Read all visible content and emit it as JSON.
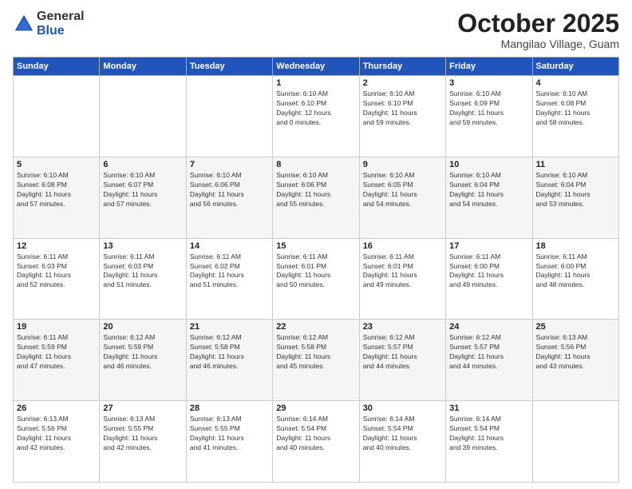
{
  "logo": {
    "general": "General",
    "blue": "Blue"
  },
  "header": {
    "month": "October 2025",
    "location": "Mangilao Village, Guam"
  },
  "weekdays": [
    "Sunday",
    "Monday",
    "Tuesday",
    "Wednesday",
    "Thursday",
    "Friday",
    "Saturday"
  ],
  "weeks": [
    [
      {
        "day": "",
        "info": ""
      },
      {
        "day": "",
        "info": ""
      },
      {
        "day": "",
        "info": ""
      },
      {
        "day": "1",
        "info": "Sunrise: 6:10 AM\nSunset: 6:10 PM\nDaylight: 12 hours\nand 0 minutes."
      },
      {
        "day": "2",
        "info": "Sunrise: 6:10 AM\nSunset: 6:10 PM\nDaylight: 11 hours\nand 59 minutes."
      },
      {
        "day": "3",
        "info": "Sunrise: 6:10 AM\nSunset: 6:09 PM\nDaylight: 11 hours\nand 59 minutes."
      },
      {
        "day": "4",
        "info": "Sunrise: 6:10 AM\nSunset: 6:08 PM\nDaylight: 11 hours\nand 58 minutes."
      }
    ],
    [
      {
        "day": "5",
        "info": "Sunrise: 6:10 AM\nSunset: 6:08 PM\nDaylight: 11 hours\nand 57 minutes."
      },
      {
        "day": "6",
        "info": "Sunrise: 6:10 AM\nSunset: 6:07 PM\nDaylight: 11 hours\nand 57 minutes."
      },
      {
        "day": "7",
        "info": "Sunrise: 6:10 AM\nSunset: 6:06 PM\nDaylight: 11 hours\nand 56 minutes."
      },
      {
        "day": "8",
        "info": "Sunrise: 6:10 AM\nSunset: 6:06 PM\nDaylight: 11 hours\nand 55 minutes."
      },
      {
        "day": "9",
        "info": "Sunrise: 6:10 AM\nSunset: 6:05 PM\nDaylight: 11 hours\nand 54 minutes."
      },
      {
        "day": "10",
        "info": "Sunrise: 6:10 AM\nSunset: 6:04 PM\nDaylight: 11 hours\nand 54 minutes."
      },
      {
        "day": "11",
        "info": "Sunrise: 6:10 AM\nSunset: 6:04 PM\nDaylight: 11 hours\nand 53 minutes."
      }
    ],
    [
      {
        "day": "12",
        "info": "Sunrise: 6:11 AM\nSunset: 6:03 PM\nDaylight: 11 hours\nand 52 minutes."
      },
      {
        "day": "13",
        "info": "Sunrise: 6:11 AM\nSunset: 6:03 PM\nDaylight: 11 hours\nand 51 minutes."
      },
      {
        "day": "14",
        "info": "Sunrise: 6:11 AM\nSunset: 6:02 PM\nDaylight: 11 hours\nand 51 minutes."
      },
      {
        "day": "15",
        "info": "Sunrise: 6:11 AM\nSunset: 6:01 PM\nDaylight: 11 hours\nand 50 minutes."
      },
      {
        "day": "16",
        "info": "Sunrise: 6:11 AM\nSunset: 6:01 PM\nDaylight: 11 hours\nand 49 minutes."
      },
      {
        "day": "17",
        "info": "Sunrise: 6:11 AM\nSunset: 6:00 PM\nDaylight: 11 hours\nand 49 minutes."
      },
      {
        "day": "18",
        "info": "Sunrise: 6:11 AM\nSunset: 6:00 PM\nDaylight: 11 hours\nand 48 minutes."
      }
    ],
    [
      {
        "day": "19",
        "info": "Sunrise: 6:11 AM\nSunset: 5:59 PM\nDaylight: 11 hours\nand 47 minutes."
      },
      {
        "day": "20",
        "info": "Sunrise: 6:12 AM\nSunset: 5:59 PM\nDaylight: 11 hours\nand 46 minutes."
      },
      {
        "day": "21",
        "info": "Sunrise: 6:12 AM\nSunset: 5:58 PM\nDaylight: 11 hours\nand 46 minutes."
      },
      {
        "day": "22",
        "info": "Sunrise: 6:12 AM\nSunset: 5:58 PM\nDaylight: 11 hours\nand 45 minutes."
      },
      {
        "day": "23",
        "info": "Sunrise: 6:12 AM\nSunset: 5:57 PM\nDaylight: 11 hours\nand 44 minutes."
      },
      {
        "day": "24",
        "info": "Sunrise: 6:12 AM\nSunset: 5:57 PM\nDaylight: 11 hours\nand 44 minutes."
      },
      {
        "day": "25",
        "info": "Sunrise: 6:13 AM\nSunset: 5:56 PM\nDaylight: 11 hours\nand 43 minutes."
      }
    ],
    [
      {
        "day": "26",
        "info": "Sunrise: 6:13 AM\nSunset: 5:56 PM\nDaylight: 11 hours\nand 42 minutes."
      },
      {
        "day": "27",
        "info": "Sunrise: 6:13 AM\nSunset: 5:55 PM\nDaylight: 11 hours\nand 42 minutes."
      },
      {
        "day": "28",
        "info": "Sunrise: 6:13 AM\nSunset: 5:55 PM\nDaylight: 11 hours\nand 41 minutes."
      },
      {
        "day": "29",
        "info": "Sunrise: 6:14 AM\nSunset: 5:54 PM\nDaylight: 11 hours\nand 40 minutes."
      },
      {
        "day": "30",
        "info": "Sunrise: 6:14 AM\nSunset: 5:54 PM\nDaylight: 11 hours\nand 40 minutes."
      },
      {
        "day": "31",
        "info": "Sunrise: 6:14 AM\nSunset: 5:54 PM\nDaylight: 11 hours\nand 39 minutes."
      },
      {
        "day": "",
        "info": ""
      }
    ]
  ]
}
